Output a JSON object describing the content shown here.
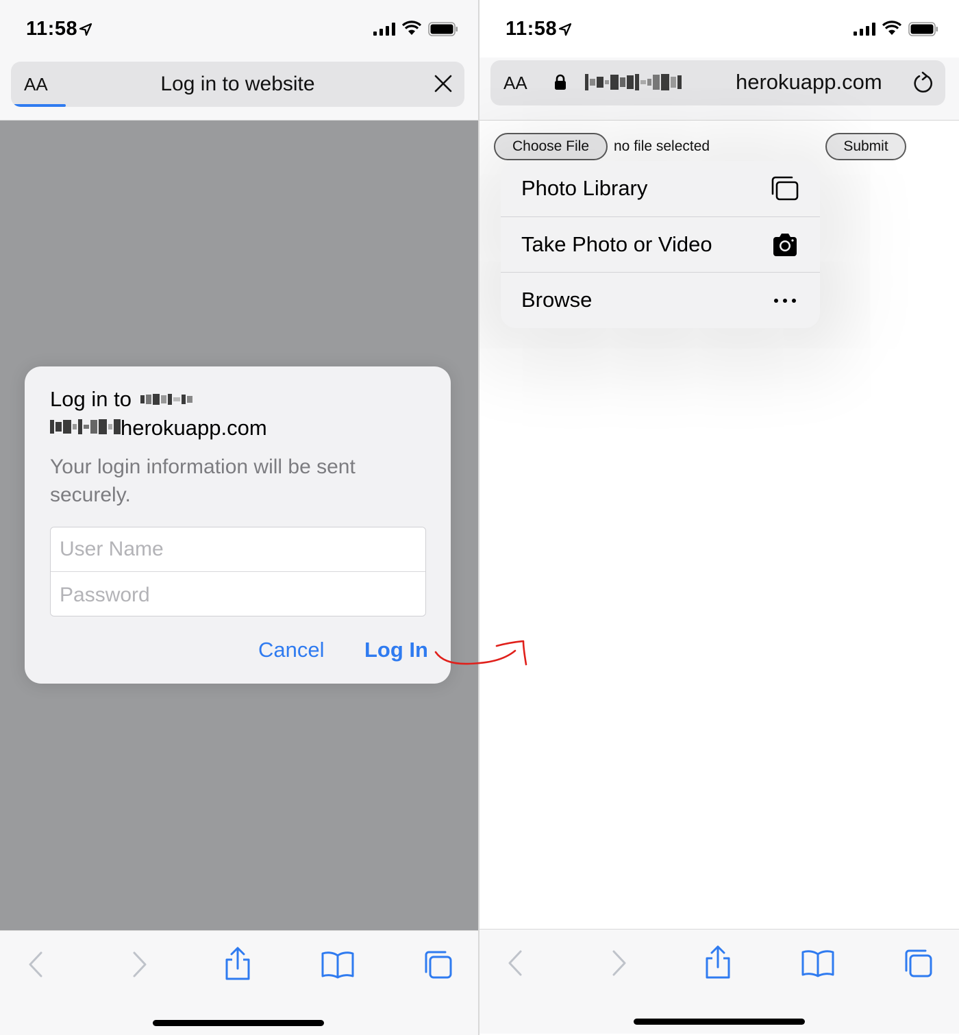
{
  "left": {
    "status": {
      "time": "11:58"
    },
    "urlbar": {
      "aa_label": "AA",
      "title": "Log in to website"
    },
    "dialog": {
      "title_prefix": "Log in to",
      "domain_suffix": "herokuapp.com",
      "message": "Your login information will be sent securely.",
      "username_placeholder": "User Name",
      "password_placeholder": "Password",
      "cancel_label": "Cancel",
      "login_label": "Log In"
    }
  },
  "right": {
    "status": {
      "time": "11:58"
    },
    "urlbar": {
      "aa_label": "AA",
      "domain_suffix": "herokuapp.com"
    },
    "page": {
      "choose_file_label": "Choose File",
      "file_status": "no file selected",
      "submit_label": "Submit"
    },
    "menu": {
      "items": [
        {
          "label": "Photo Library",
          "icon": "photo-library-icon"
        },
        {
          "label": "Take Photo or Video",
          "icon": "camera-icon"
        },
        {
          "label": "Browse",
          "icon": "more-icon"
        }
      ]
    }
  },
  "colors": {
    "accent": "#2f7bf0",
    "dim_overlay": "#9a9b9d",
    "annotation": "#e0201b"
  },
  "toolbar_icons": [
    "back-icon",
    "forward-icon",
    "share-icon",
    "bookmarks-icon",
    "tabs-icon"
  ]
}
